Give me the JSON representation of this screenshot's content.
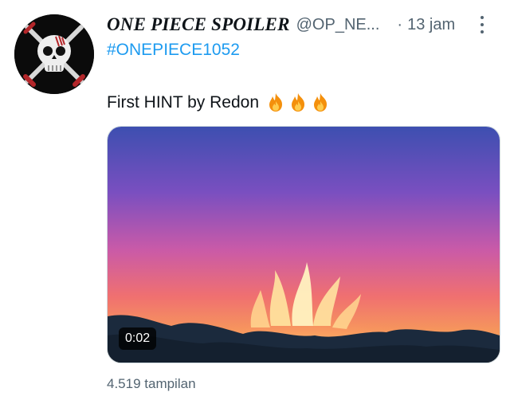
{
  "tweet": {
    "display_name": "ONE PIECE SPOILER",
    "handle": "@OP_NE...",
    "separator": "·",
    "timestamp": "13 jam",
    "hashtag": "#ONEPIECE1052",
    "text": "First HINT by Redon",
    "emoji": [
      "fire",
      "fire",
      "fire"
    ],
    "views": "4.519 tampilan"
  },
  "media": {
    "type": "video",
    "duration": "0:02"
  },
  "colors": {
    "link": "#1d9bf0",
    "secondary_text": "#536471",
    "primary_text": "#0f1419",
    "avatar_bg": "#0b0b0b"
  }
}
